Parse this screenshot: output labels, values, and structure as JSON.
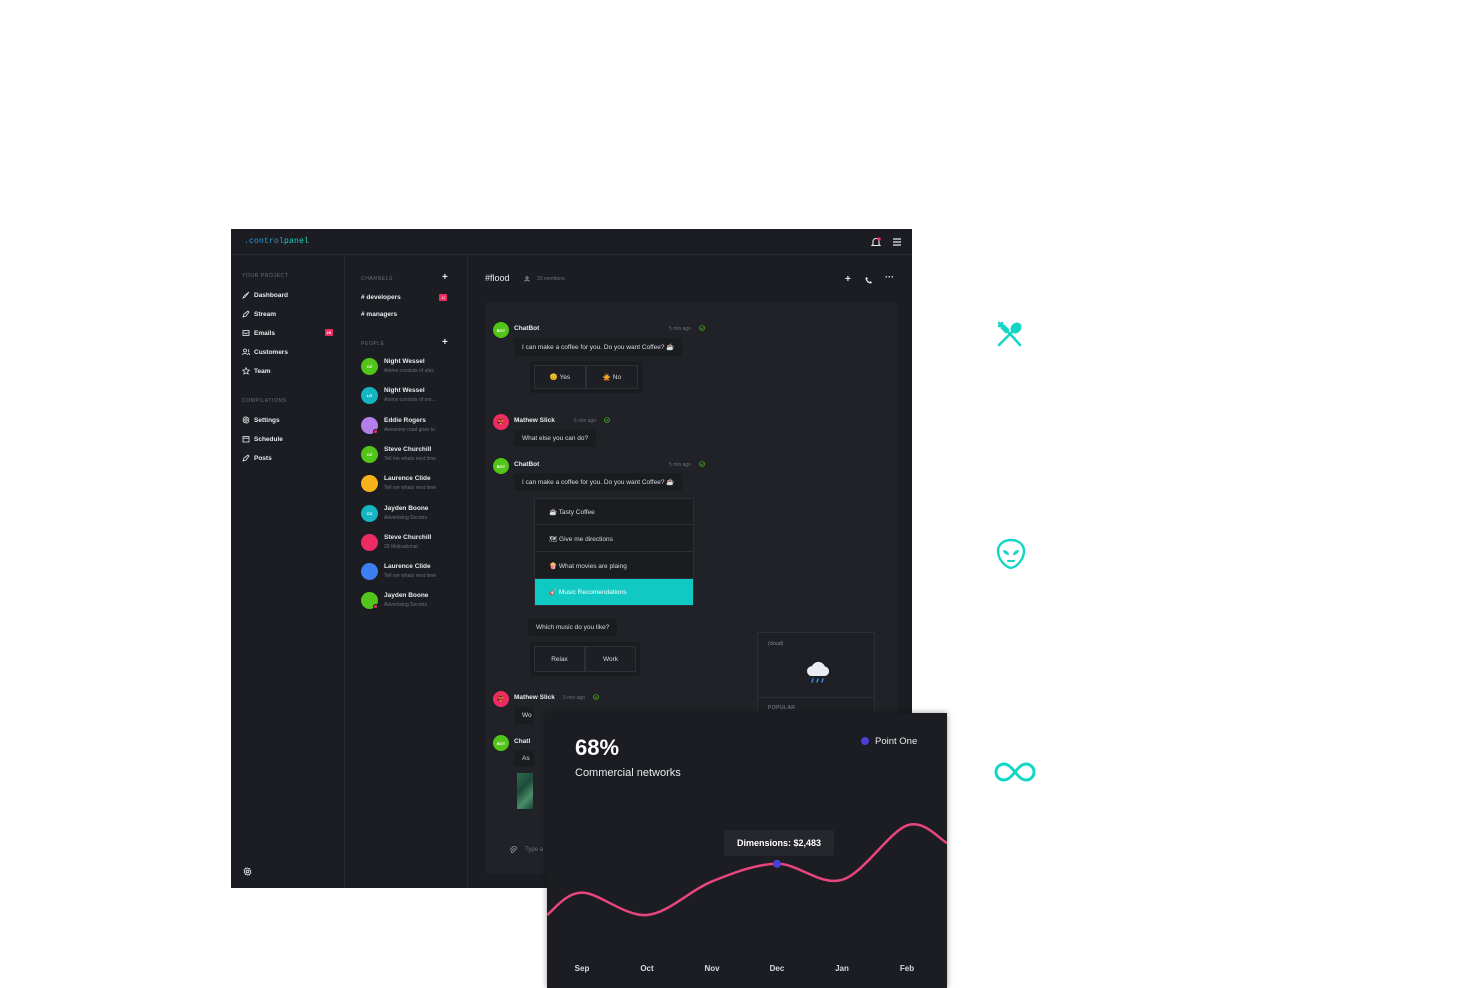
{
  "app": {
    "logo_prefix": ".control",
    "logo_suffix": "panel"
  },
  "sidebar": {
    "section1": "YOUR PROJECT",
    "items": [
      {
        "label": "Dashboard",
        "icon": "rocket-icon"
      },
      {
        "label": "Stream",
        "icon": "pen-icon"
      },
      {
        "label": "Emails",
        "icon": "inbox-icon",
        "badge": "25"
      },
      {
        "label": "Customers",
        "icon": "users-icon"
      },
      {
        "label": "Team",
        "icon": "star-icon"
      }
    ],
    "section2": "COMPILATIONS",
    "items2": [
      {
        "label": "Settings",
        "icon": "gear-icon"
      },
      {
        "label": "Schedule",
        "icon": "calendar-icon"
      },
      {
        "label": "Posts",
        "icon": "pen-icon"
      }
    ]
  },
  "channels": {
    "title": "CHANNELS",
    "items": [
      {
        "label": "# developers",
        "badge": "12"
      },
      {
        "label": "# managers"
      }
    ]
  },
  "people": {
    "title": "PEOPLE",
    "items": [
      {
        "name": "Night Wessel",
        "msg": "Atoms consists of ules",
        "initials": "OZ",
        "color": "#52c41a"
      },
      {
        "name": "Night Wessel",
        "msg": "Atoms consists of mo...",
        "initials": "LG",
        "color": "#16b5c2"
      },
      {
        "name": "Eddie Rogers",
        "msg": "Awesome road goes to",
        "initials": "",
        "color": "#b37feb",
        "dot": true
      },
      {
        "name": "Steve Churchill",
        "msg": "Tell me whats next time",
        "initials": "OZ",
        "color": "#52c41a"
      },
      {
        "name": "Laurence Clide",
        "msg": "Tell me whats next time",
        "initials": "",
        "color": "#f6b21b"
      },
      {
        "name": "Jayden Boone",
        "msg": "Advertising Secrets",
        "initials": "OZ",
        "color": "#16b5c2"
      },
      {
        "name": "Steve Churchill",
        "msg": "29 Motivational",
        "initials": "",
        "color": "#ee2b63"
      },
      {
        "name": "Laurence Clide",
        "msg": "Tell me whats next time",
        "initials": "",
        "color": "#3d7ff0"
      },
      {
        "name": "Jayden Boone",
        "msg": "Advertising Secrets",
        "initials": "",
        "color": "#52c41a",
        "dot": true
      }
    ]
  },
  "chat": {
    "channel": "#flood",
    "members": "23 members",
    "messages": {
      "m1": {
        "avatar": "BOT",
        "name": "ChatBot",
        "time": "5 min ago",
        "text": "I can make a coffee for you. Do you want Coffee? ☕"
      },
      "choices1": [
        "😊 Yes",
        "🙅 No"
      ],
      "m2": {
        "name": "Mathew Slick",
        "time": "5 min ago",
        "text": "What else you can do?"
      },
      "m3": {
        "avatar": "BOT",
        "name": "ChatBot",
        "time": "5 min ago",
        "text": "I can make a coffee for you. Do you want Coffee? ☕"
      },
      "menu": [
        "☕ Tasty Coffee",
        "🗺 Give me directions",
        "🍿 What movies are plaing",
        "🎸 Music Recomendations"
      ],
      "q": "Which music do you like?",
      "choices2": [
        "Relax",
        "Work"
      ],
      "m4": {
        "name": "Mathew Slick",
        "time": "5 min ago",
        "text": "Wo"
      },
      "m5": {
        "avatar": "BOT",
        "name": "Chatl",
        "text": "As"
      },
      "input_placeholder": "Type a"
    },
    "weather": {
      "label": "(cloud)",
      "footer": "POPULAR"
    }
  },
  "overlay": {
    "percent": "68%",
    "subtitle": "Commercial networks",
    "legend": "Point One",
    "tooltip": "Dimensions: $2,483"
  },
  "chart_data": {
    "type": "line",
    "categories": [
      "Sep",
      "Oct",
      "Nov",
      "Dec",
      "Jan",
      "Feb"
    ],
    "series": [
      {
        "name": "Point One",
        "color": "#e8457f",
        "values": [
          44,
          30,
          51,
          62,
          52,
          86
        ]
      }
    ],
    "ylim": [
      0,
      100
    ],
    "highlight": {
      "category": "Dec",
      "label": "Dimensions: $2,483"
    }
  },
  "accent": "#14d6c4",
  "side_icons": [
    "fork-spoon-icon",
    "alien-icon",
    "infinity-icon"
  ]
}
